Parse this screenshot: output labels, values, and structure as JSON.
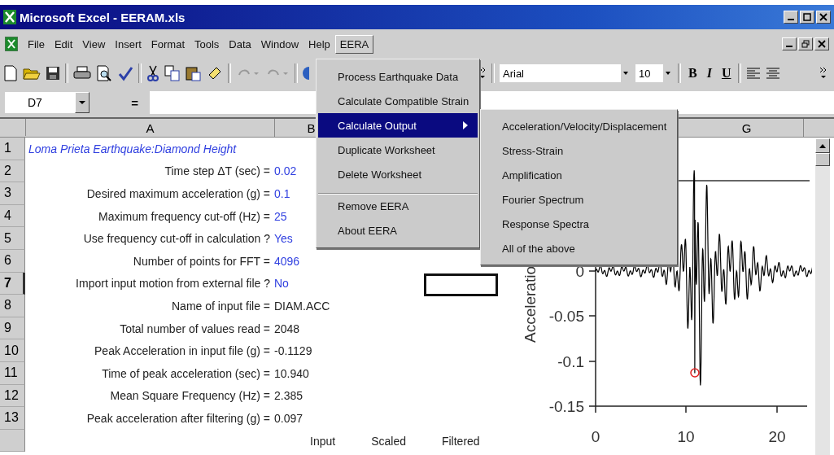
{
  "window": {
    "title": "Microsoft Excel - EERAM.xls"
  },
  "menu_bar": [
    {
      "label": "File",
      "selected": false
    },
    {
      "label": "Edit",
      "selected": false
    },
    {
      "label": "View",
      "selected": false
    },
    {
      "label": "Insert",
      "selected": false
    },
    {
      "label": "Format",
      "selected": false
    },
    {
      "label": "Tools",
      "selected": false
    },
    {
      "label": "Data",
      "selected": false
    },
    {
      "label": "Window",
      "selected": false
    },
    {
      "label": "Help",
      "selected": false
    },
    {
      "label": "EERA",
      "selected": true
    }
  ],
  "toolbar": {
    "font": "Arial",
    "size": "10",
    "bold": "B",
    "italic": "I",
    "underline": "U"
  },
  "formula_bar": {
    "name_box": "D7",
    "equals": "="
  },
  "columns": [
    "A",
    "B",
    "G"
  ],
  "rows": [
    {
      "number": "1",
      "kind": "title",
      "label": "Loma Prieta Earthquake:Diamond Height",
      "selected": false
    },
    {
      "number": "2",
      "kind": "input",
      "label": "Time step ΔT (sec) =",
      "value": "0.02",
      "selected": false
    },
    {
      "number": "3",
      "kind": "input",
      "label": "Desired maximum acceleration (g) =",
      "value": "0.1",
      "selected": false
    },
    {
      "number": "4",
      "kind": "input",
      "label": "Maximum frequency cut-off (Hz) =",
      "value": "25",
      "selected": false
    },
    {
      "number": "5",
      "kind": "input",
      "label": "Use frequency cut-off in calculation ?",
      "value": "Yes",
      "selected": false
    },
    {
      "number": "6",
      "kind": "input",
      "label": "Number of points for FFT =",
      "value": "4096",
      "selected": false
    },
    {
      "number": "7",
      "kind": "input",
      "label": "Import input motion from external file ?",
      "value": "No",
      "selected": true
    },
    {
      "number": "8",
      "kind": "computed",
      "label": "Name of input file =",
      "value": "DIAM.ACC",
      "selected": false
    },
    {
      "number": "9",
      "kind": "computed",
      "label": "Total number of values read =",
      "value": "2048",
      "selected": false
    },
    {
      "number": "10",
      "kind": "computed",
      "label": "Peak Acceleration in input file (g) =",
      "value": "-0.1129",
      "selected": false
    },
    {
      "number": "11",
      "kind": "computed",
      "label": "Time of peak acceleration (sec) =",
      "value": "10.940",
      "selected": false
    },
    {
      "number": "12",
      "kind": "computed",
      "label": "Mean Square Frequency (Hz) =",
      "value": "2.385",
      "selected": false
    },
    {
      "number": "13",
      "kind": "computed",
      "label": "Peak acceleration after filtering (g) =",
      "value": "0.097",
      "selected": false
    }
  ],
  "row_14": [
    "Input",
    "Scaled",
    "Filtered"
  ],
  "eera_menu": [
    {
      "label": "Process Earthquake Data",
      "kind": "command",
      "selected": false,
      "separator_above": false
    },
    {
      "label": "Calculate Compatible Strain",
      "kind": "command",
      "selected": false,
      "separator_above": false
    },
    {
      "label": "Calculate Output",
      "kind": "submenu",
      "selected": true,
      "separator_above": false
    },
    {
      "label": "Duplicate Worksheet",
      "kind": "command",
      "selected": false,
      "separator_above": false
    },
    {
      "label": "Delete Worksheet",
      "kind": "command",
      "selected": false,
      "separator_above": false
    },
    {
      "label": "Remove EERA",
      "kind": "command",
      "selected": false,
      "separator_above": true
    },
    {
      "label": "About EERA",
      "kind": "command",
      "selected": false,
      "separator_above": false
    }
  ],
  "submenu": [
    "Acceleration/Velocity/Displacement",
    "Stress-Strain",
    "Amplification",
    "Fourier Spectrum",
    "Response Spectra",
    "All of the above"
  ],
  "chart": {
    "ylabel": "Acceleratio",
    "yticks": [
      "0",
      "-0.05",
      "-0.1",
      "-0.15"
    ],
    "xticks": [
      "0",
      "10",
      "20"
    ]
  }
}
